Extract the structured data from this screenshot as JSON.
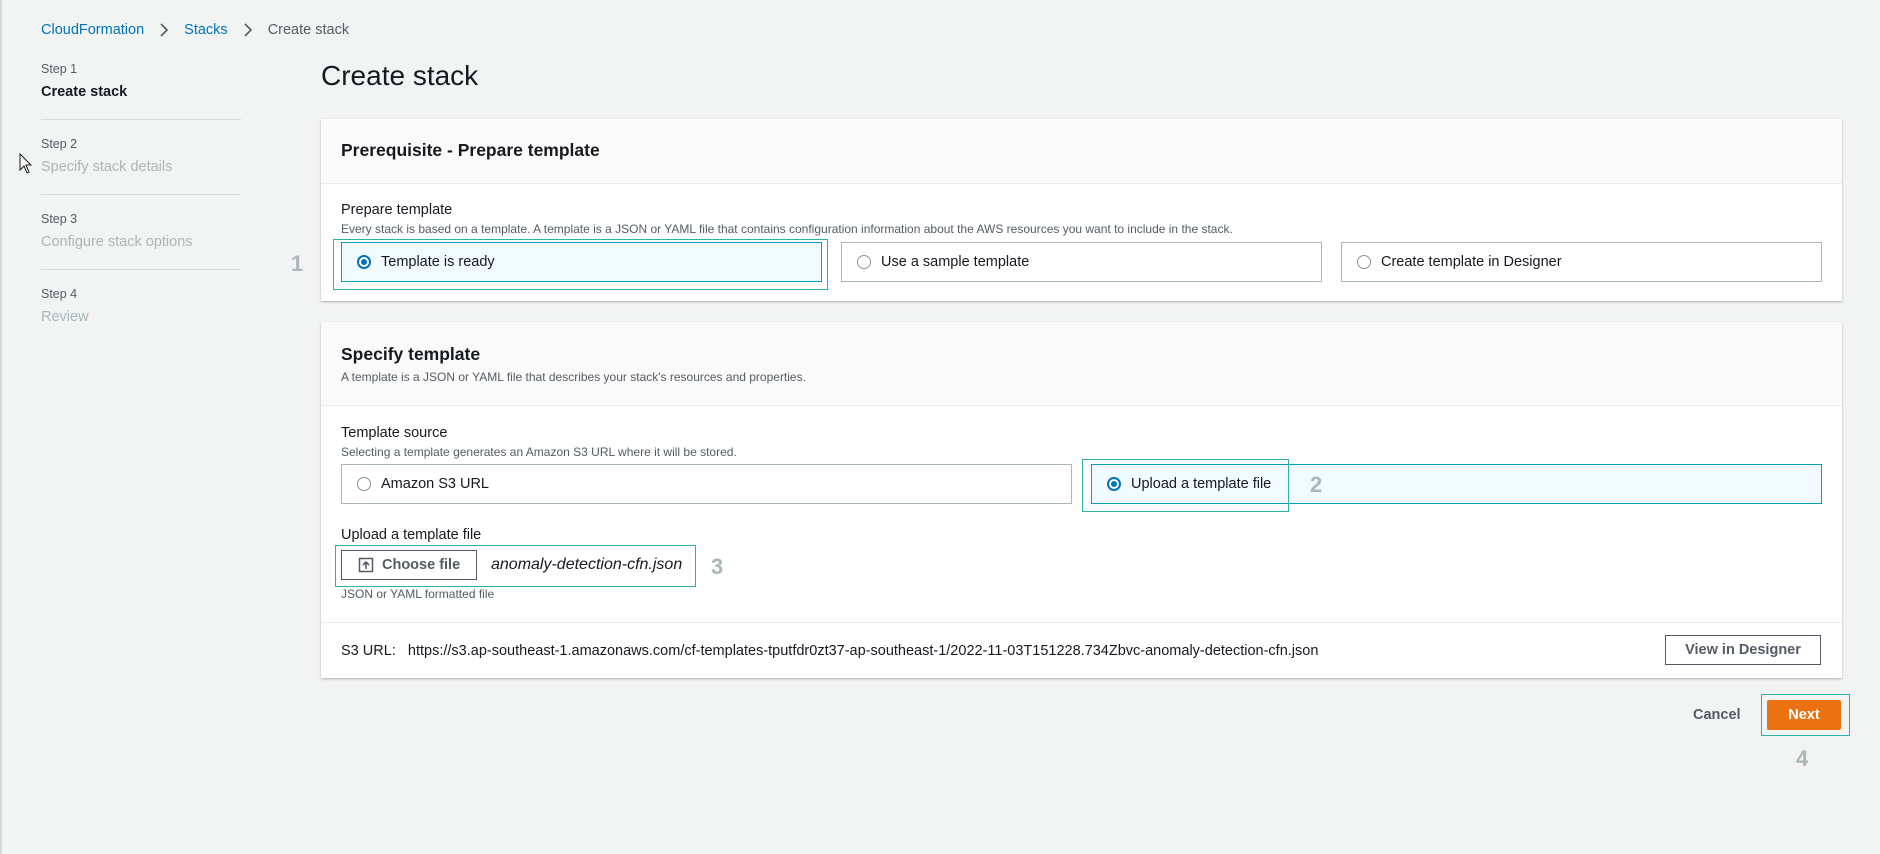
{
  "breadcrumb": [
    "CloudFormation",
    "Stacks",
    "Create stack"
  ],
  "steps": [
    {
      "num": "Step 1",
      "name": "Create stack",
      "active": true
    },
    {
      "num": "Step 2",
      "name": "Specify stack details",
      "active": false
    },
    {
      "num": "Step 3",
      "name": "Configure stack options",
      "active": false
    },
    {
      "num": "Step 4",
      "name": "Review",
      "active": false
    }
  ],
  "page_title": "Create stack",
  "prereq": {
    "title": "Prerequisite - Prepare template",
    "label": "Prepare template",
    "desc": "Every stack is based on a template. A template is a JSON or YAML file that contains configuration information about the AWS resources you want to include in the stack.",
    "options": [
      {
        "label": "Template is ready",
        "selected": true
      },
      {
        "label": "Use a sample template",
        "selected": false
      },
      {
        "label": "Create template in Designer",
        "selected": false
      }
    ]
  },
  "specify": {
    "title": "Specify template",
    "subtitle": "A template is a JSON or YAML file that describes your stack's resources and properties.",
    "source_label": "Template source",
    "source_desc": "Selecting a template generates an Amazon S3 URL where it will be stored.",
    "source_options": [
      {
        "label": "Amazon S3 URL",
        "selected": false
      },
      {
        "label": "Upload a template file",
        "selected": true
      }
    ],
    "upload_label": "Upload a template file",
    "choose_file": "Choose file",
    "file_name": "anomaly-detection-cfn.json",
    "file_hint": "JSON or YAML formatted file",
    "s3_url_label": "S3 URL:",
    "s3_url": "https://s3.ap-southeast-1.amazonaws.com/cf-templates-tputfdr0zt37-ap-southeast-1/2022-11-03T151228.734Zbvc-anomaly-detection-cfn.json",
    "view_designer": "View in Designer"
  },
  "actions": {
    "cancel": "Cancel",
    "next": "Next"
  },
  "annotations": [
    "1",
    "2",
    "3",
    "4"
  ],
  "colors": {
    "accent": "#0073bb",
    "primary_button": "#ec7211",
    "annotation_box": "#2bb1a6"
  }
}
